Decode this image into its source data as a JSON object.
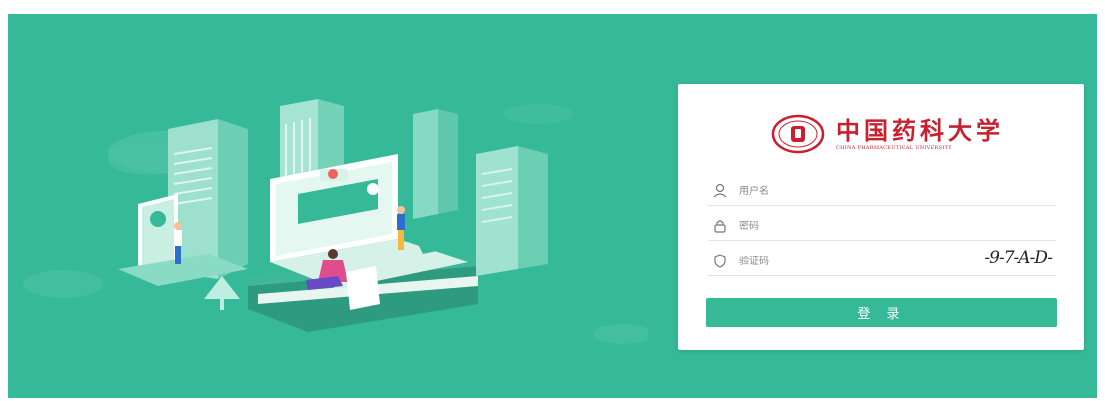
{
  "brand": {
    "name": "中国药科大学",
    "name_en": "CHINA PHARMACEUTICAL UNIVERSITY"
  },
  "login": {
    "username_placeholder": "用户名",
    "password_placeholder": "密码",
    "captcha_placeholder": "验证码",
    "captcha_text": "-9-7-A-D-",
    "submit_label": "登 录"
  },
  "colors": {
    "primary": "#35b998",
    "brand_red": "#c8202f",
    "background": "#ffffff"
  },
  "icons": {
    "username": "user-icon",
    "password": "lock-icon",
    "captcha": "shield-icon"
  }
}
